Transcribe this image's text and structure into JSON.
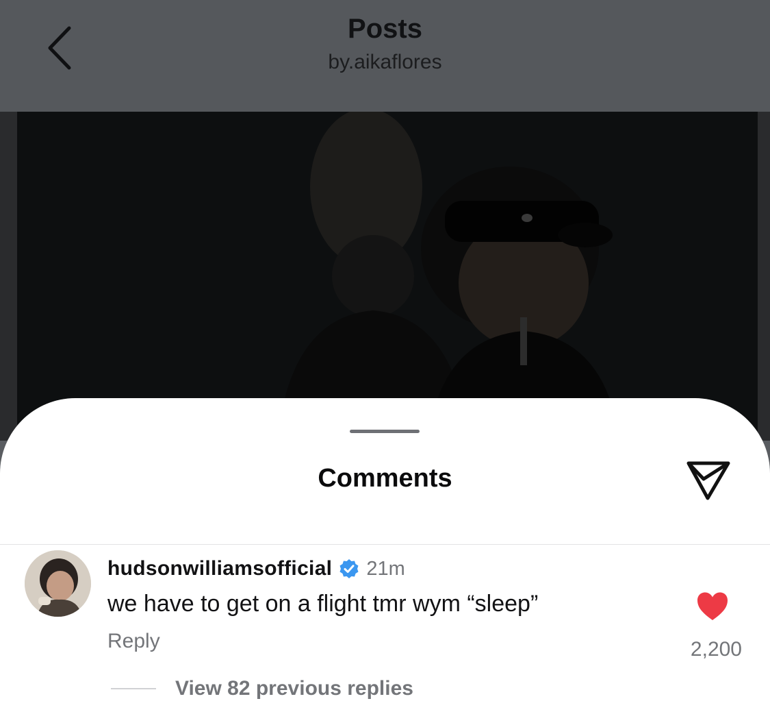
{
  "header": {
    "title": "Posts",
    "subtitle": "by.aikaflores",
    "back_icon": "chevron-left-icon"
  },
  "photo": {
    "alt": ""
  },
  "comments_sheet": {
    "title": "Comments",
    "send_icon": "paper-plane-icon"
  },
  "comment": {
    "username": "hudsonwilliamsofficial",
    "verified": true,
    "time": "21m",
    "text": "we have to get on a flight tmr wym “sleep”",
    "reply_label": "Reply",
    "liked": true,
    "like_count": "2,200",
    "view_replies": "View 82 previous replies"
  },
  "colors": {
    "like_red": "#ed3a45",
    "verified_blue": "#3b97f0",
    "muted_text": "#737579"
  }
}
